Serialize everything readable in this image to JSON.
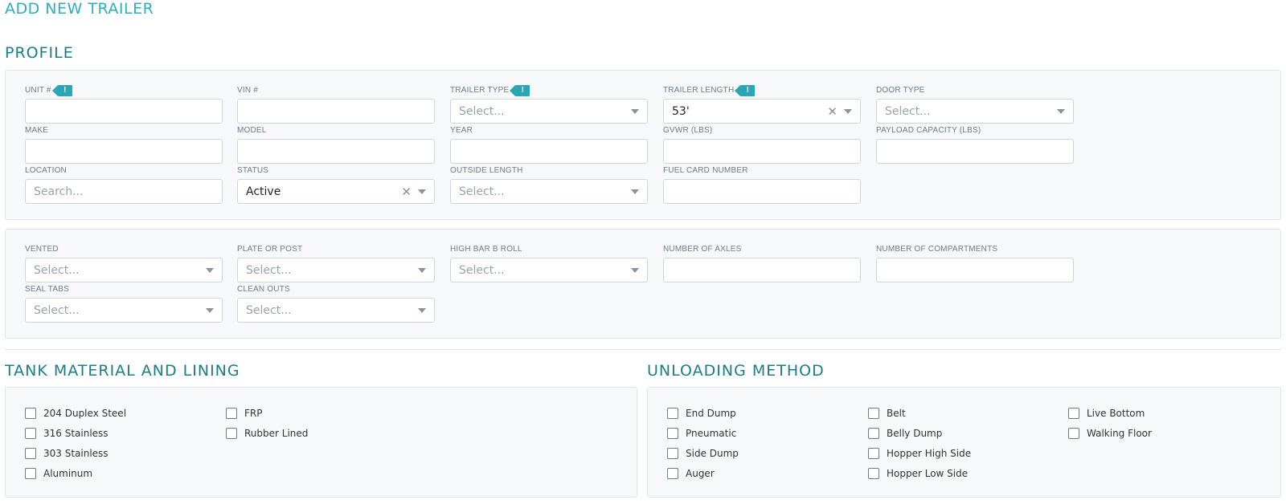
{
  "page_title": "ADD NEW TRAILER",
  "profile": {
    "title": "PROFILE",
    "fields": {
      "unit": {
        "label": "UNIT #",
        "value": ""
      },
      "vin": {
        "label": "VIN #",
        "value": ""
      },
      "trailer_type": {
        "label": "TRAILER TYPE",
        "placeholder": "Select..."
      },
      "trailer_length": {
        "label": "TRAILER LENGTH",
        "value": "53'"
      },
      "door_type": {
        "label": "DOOR TYPE",
        "placeholder": "Select..."
      },
      "make": {
        "label": "MAKE",
        "value": ""
      },
      "model": {
        "label": "MODEL",
        "value": ""
      },
      "year": {
        "label": "YEAR",
        "value": ""
      },
      "gvwr": {
        "label": "GVWR (LBS)",
        "value": ""
      },
      "payload": {
        "label": "PAYLOAD CAPACITY (LBS)",
        "value": ""
      },
      "location": {
        "label": "LOCATION",
        "placeholder": "Search..."
      },
      "status": {
        "label": "STATUS",
        "value": "Active"
      },
      "outside_length": {
        "label": "OUTSIDE LENGTH",
        "placeholder": "Select..."
      },
      "fuel_card": {
        "label": "FUEL CARD NUMBER",
        "value": ""
      }
    },
    "required_icon": "!"
  },
  "specs": {
    "vented": {
      "label": "VENTED",
      "placeholder": "Select..."
    },
    "plate_or_post": {
      "label": "PLATE OR POST",
      "placeholder": "Select..."
    },
    "high_bar": {
      "label": "HIGH BAR B ROLL",
      "placeholder": "Select..."
    },
    "axles": {
      "label": "NUMBER OF AXLES",
      "value": ""
    },
    "compartments": {
      "label": "NUMBER OF COMPARTMENTS",
      "value": ""
    },
    "seal_tabs": {
      "label": "SEAL TABS",
      "placeholder": "Select..."
    },
    "clean_outs": {
      "label": "CLEAN OUTS",
      "placeholder": "Select..."
    }
  },
  "tank_material": {
    "title": "TANK MATERIAL AND LINING",
    "options": [
      "204 Duplex Steel",
      "316 Stainless",
      "303 Stainless",
      "Aluminum",
      "FRP",
      "Rubber Lined"
    ]
  },
  "unloading": {
    "title": "UNLOADING METHOD",
    "options": [
      "End Dump",
      "Pneumatic",
      "Side Dump",
      "Auger",
      "Belt",
      "Belly Dump",
      "Hopper High Side",
      "Hopper Low Side",
      "Live Bottom",
      "Walking Floor"
    ]
  },
  "colors": {
    "accent": "#2eaec1",
    "section_title": "#1b7d8a",
    "required_tag": "#2aa6b6"
  }
}
